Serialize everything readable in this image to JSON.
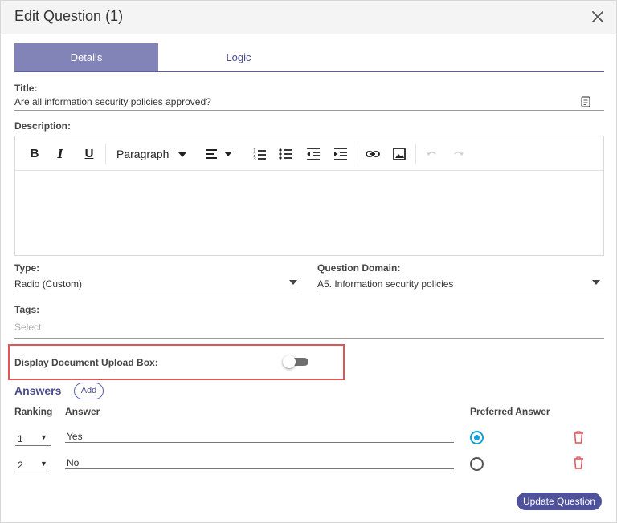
{
  "dialog": {
    "title": "Edit Question (1)"
  },
  "tabs": [
    {
      "label": "Details",
      "active": true
    },
    {
      "label": "Logic",
      "active": false
    }
  ],
  "title_field": {
    "label": "Title:",
    "value": "Are all information security policies approved?"
  },
  "description": {
    "label": "Description:",
    "paragraph_select": "Paragraph",
    "toolbar_icons": [
      "bold-icon",
      "italic-icon",
      "underline-icon",
      "align-icon",
      "ordered-list-icon",
      "bullet-list-icon",
      "outdent-icon",
      "indent-icon",
      "link-icon",
      "image-icon",
      "undo-icon",
      "redo-icon"
    ],
    "bold": "B",
    "italic": "I",
    "underline": "U"
  },
  "type_field": {
    "label": "Type:",
    "value": "Radio (Custom)"
  },
  "domain_field": {
    "label": "Question Domain:",
    "value": "A5. Information security policies"
  },
  "tags_field": {
    "label": "Tags:",
    "placeholder": "Select"
  },
  "upload_box": {
    "label": "Display Document Upload Box:",
    "enabled": false
  },
  "answers": {
    "title": "Answers",
    "add_label": "Add",
    "headers": {
      "ranking": "Ranking",
      "answer": "Answer",
      "preferred": "Preferred Answer"
    },
    "rows": [
      {
        "rank": "1",
        "text": "Yes",
        "preferred": true
      },
      {
        "rank": "2",
        "text": "No",
        "preferred": false
      }
    ]
  },
  "footer": {
    "update_label": "Update Question"
  },
  "colors": {
    "accent": "#4f529a",
    "tab_active": "#8284b8",
    "radio_selected": "#1a9ed8",
    "delete": "#e05555",
    "highlight": "#e05555"
  }
}
